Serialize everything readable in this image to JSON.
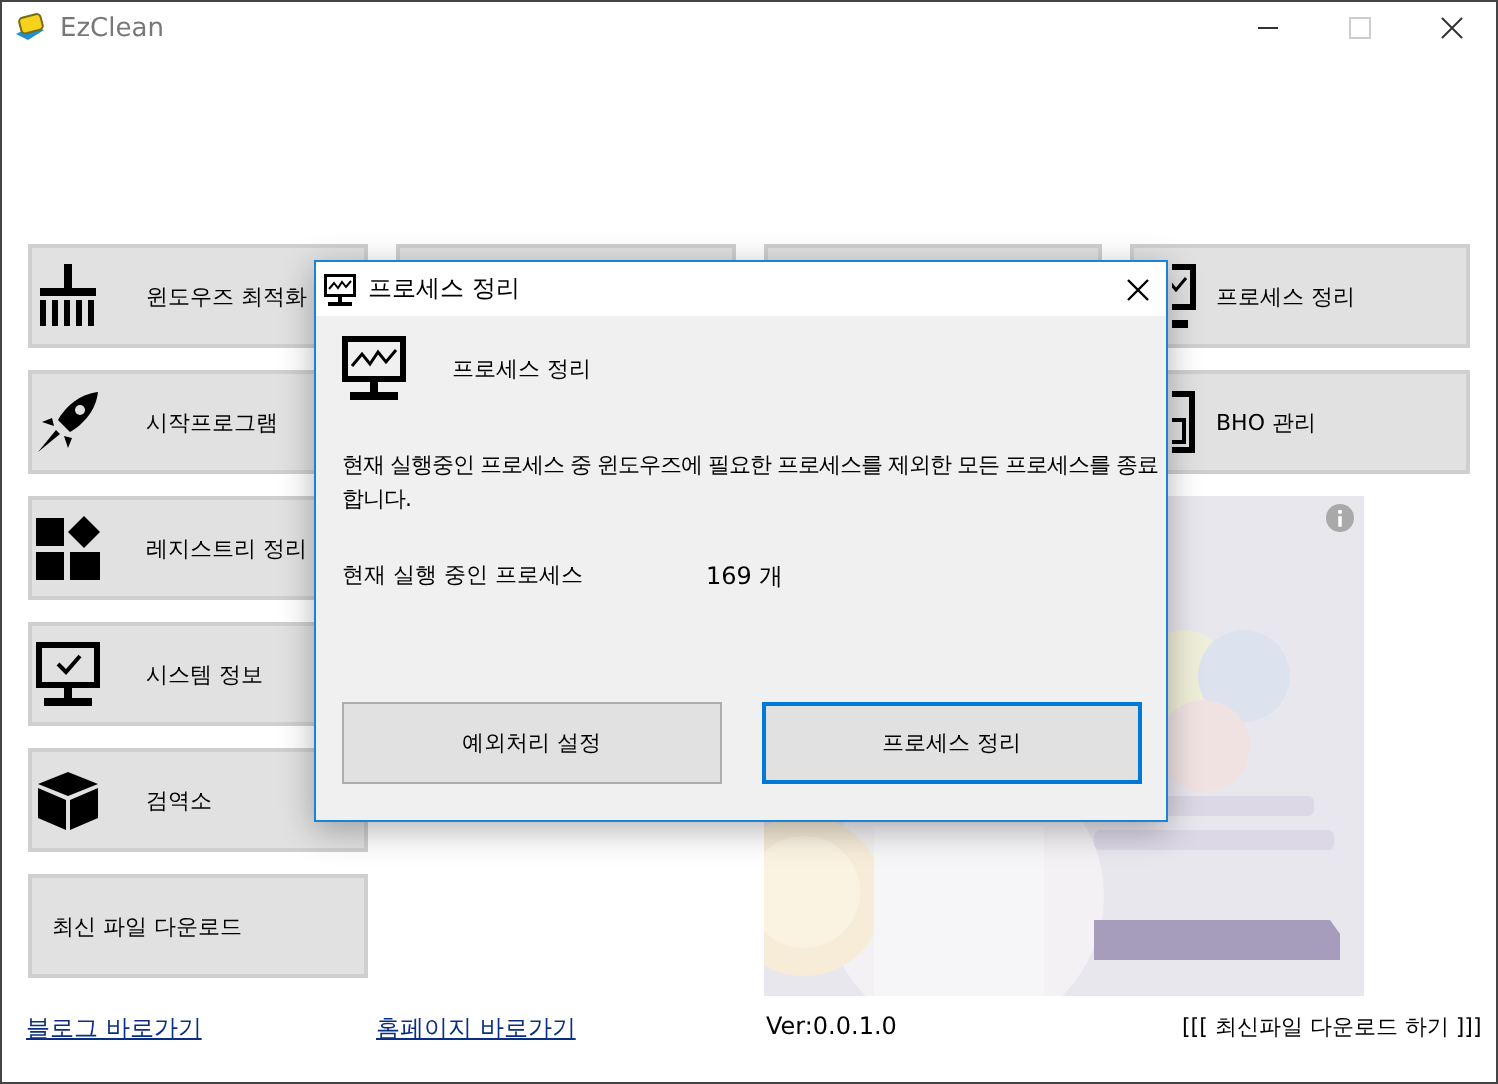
{
  "window": {
    "title": "EzClean"
  },
  "left_tiles": [
    {
      "label": "윈도우즈 최적화",
      "kind": "broom"
    },
    {
      "label": "시작프로그램",
      "kind": "rocket"
    },
    {
      "label": "레지스트리 정리",
      "kind": "blocks"
    },
    {
      "label": "시스템 정보",
      "kind": "monitor"
    },
    {
      "label": "검역소",
      "kind": "box"
    },
    {
      "label": "최신 파일 다운로드",
      "kind": "plain"
    }
  ],
  "right_tiles": [
    {
      "label": "프로세스 정리",
      "kind": "monitor"
    },
    {
      "label": "BHO 관리",
      "kind": "frame"
    }
  ],
  "footer": {
    "links": [
      "블로그 바로가기",
      "홈페이지 바로가기"
    ],
    "version": "Ver:0.0.1.0",
    "download": "[[[ 최신파일 다운로드 하기 ]]]"
  },
  "dialog": {
    "title": "프로세스 정리",
    "heading": "프로세스 정리",
    "description": "현재 실행중인 프로세스 중 윈도우즈에 필요한 프로세스를 제외한 모든 프로세스를 종료합니다.",
    "count_label": "현재 실행 중인 프로세스",
    "count_value": "169 개",
    "buttons": [
      {
        "label": "예외처리 설정",
        "selected": false
      },
      {
        "label": "프로세스 정리",
        "selected": true
      }
    ]
  }
}
